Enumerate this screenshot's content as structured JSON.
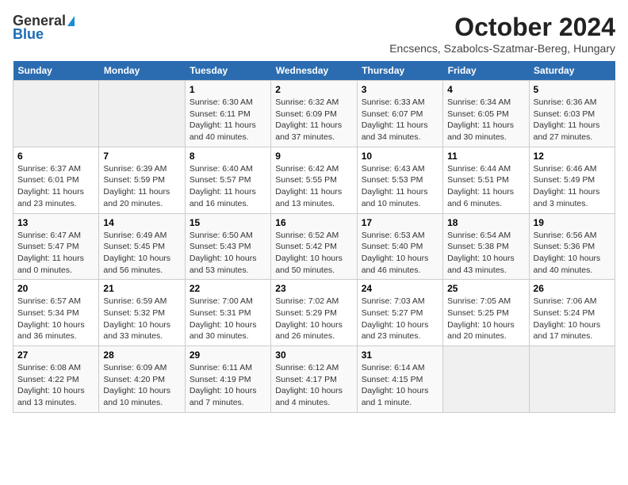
{
  "logo": {
    "line1": "General",
    "line2": "Blue"
  },
  "title": "October 2024",
  "subtitle": "Encsencs, Szabolcs-Szatmar-Bereg, Hungary",
  "weekdays": [
    "Sunday",
    "Monday",
    "Tuesday",
    "Wednesday",
    "Thursday",
    "Friday",
    "Saturday"
  ],
  "weeks": [
    [
      {
        "num": "",
        "sunrise": "",
        "sunset": "",
        "daylight": ""
      },
      {
        "num": "",
        "sunrise": "",
        "sunset": "",
        "daylight": ""
      },
      {
        "num": "1",
        "sunrise": "Sunrise: 6:30 AM",
        "sunset": "Sunset: 6:11 PM",
        "daylight": "Daylight: 11 hours and 40 minutes."
      },
      {
        "num": "2",
        "sunrise": "Sunrise: 6:32 AM",
        "sunset": "Sunset: 6:09 PM",
        "daylight": "Daylight: 11 hours and 37 minutes."
      },
      {
        "num": "3",
        "sunrise": "Sunrise: 6:33 AM",
        "sunset": "Sunset: 6:07 PM",
        "daylight": "Daylight: 11 hours and 34 minutes."
      },
      {
        "num": "4",
        "sunrise": "Sunrise: 6:34 AM",
        "sunset": "Sunset: 6:05 PM",
        "daylight": "Daylight: 11 hours and 30 minutes."
      },
      {
        "num": "5",
        "sunrise": "Sunrise: 6:36 AM",
        "sunset": "Sunset: 6:03 PM",
        "daylight": "Daylight: 11 hours and 27 minutes."
      }
    ],
    [
      {
        "num": "6",
        "sunrise": "Sunrise: 6:37 AM",
        "sunset": "Sunset: 6:01 PM",
        "daylight": "Daylight: 11 hours and 23 minutes."
      },
      {
        "num": "7",
        "sunrise": "Sunrise: 6:39 AM",
        "sunset": "Sunset: 5:59 PM",
        "daylight": "Daylight: 11 hours and 20 minutes."
      },
      {
        "num": "8",
        "sunrise": "Sunrise: 6:40 AM",
        "sunset": "Sunset: 5:57 PM",
        "daylight": "Daylight: 11 hours and 16 minutes."
      },
      {
        "num": "9",
        "sunrise": "Sunrise: 6:42 AM",
        "sunset": "Sunset: 5:55 PM",
        "daylight": "Daylight: 11 hours and 13 minutes."
      },
      {
        "num": "10",
        "sunrise": "Sunrise: 6:43 AM",
        "sunset": "Sunset: 5:53 PM",
        "daylight": "Daylight: 11 hours and 10 minutes."
      },
      {
        "num": "11",
        "sunrise": "Sunrise: 6:44 AM",
        "sunset": "Sunset: 5:51 PM",
        "daylight": "Daylight: 11 hours and 6 minutes."
      },
      {
        "num": "12",
        "sunrise": "Sunrise: 6:46 AM",
        "sunset": "Sunset: 5:49 PM",
        "daylight": "Daylight: 11 hours and 3 minutes."
      }
    ],
    [
      {
        "num": "13",
        "sunrise": "Sunrise: 6:47 AM",
        "sunset": "Sunset: 5:47 PM",
        "daylight": "Daylight: 11 hours and 0 minutes."
      },
      {
        "num": "14",
        "sunrise": "Sunrise: 6:49 AM",
        "sunset": "Sunset: 5:45 PM",
        "daylight": "Daylight: 10 hours and 56 minutes."
      },
      {
        "num": "15",
        "sunrise": "Sunrise: 6:50 AM",
        "sunset": "Sunset: 5:43 PM",
        "daylight": "Daylight: 10 hours and 53 minutes."
      },
      {
        "num": "16",
        "sunrise": "Sunrise: 6:52 AM",
        "sunset": "Sunset: 5:42 PM",
        "daylight": "Daylight: 10 hours and 50 minutes."
      },
      {
        "num": "17",
        "sunrise": "Sunrise: 6:53 AM",
        "sunset": "Sunset: 5:40 PM",
        "daylight": "Daylight: 10 hours and 46 minutes."
      },
      {
        "num": "18",
        "sunrise": "Sunrise: 6:54 AM",
        "sunset": "Sunset: 5:38 PM",
        "daylight": "Daylight: 10 hours and 43 minutes."
      },
      {
        "num": "19",
        "sunrise": "Sunrise: 6:56 AM",
        "sunset": "Sunset: 5:36 PM",
        "daylight": "Daylight: 10 hours and 40 minutes."
      }
    ],
    [
      {
        "num": "20",
        "sunrise": "Sunrise: 6:57 AM",
        "sunset": "Sunset: 5:34 PM",
        "daylight": "Daylight: 10 hours and 36 minutes."
      },
      {
        "num": "21",
        "sunrise": "Sunrise: 6:59 AM",
        "sunset": "Sunset: 5:32 PM",
        "daylight": "Daylight: 10 hours and 33 minutes."
      },
      {
        "num": "22",
        "sunrise": "Sunrise: 7:00 AM",
        "sunset": "Sunset: 5:31 PM",
        "daylight": "Daylight: 10 hours and 30 minutes."
      },
      {
        "num": "23",
        "sunrise": "Sunrise: 7:02 AM",
        "sunset": "Sunset: 5:29 PM",
        "daylight": "Daylight: 10 hours and 26 minutes."
      },
      {
        "num": "24",
        "sunrise": "Sunrise: 7:03 AM",
        "sunset": "Sunset: 5:27 PM",
        "daylight": "Daylight: 10 hours and 23 minutes."
      },
      {
        "num": "25",
        "sunrise": "Sunrise: 7:05 AM",
        "sunset": "Sunset: 5:25 PM",
        "daylight": "Daylight: 10 hours and 20 minutes."
      },
      {
        "num": "26",
        "sunrise": "Sunrise: 7:06 AM",
        "sunset": "Sunset: 5:24 PM",
        "daylight": "Daylight: 10 hours and 17 minutes."
      }
    ],
    [
      {
        "num": "27",
        "sunrise": "Sunrise: 6:08 AM",
        "sunset": "Sunset: 4:22 PM",
        "daylight": "Daylight: 10 hours and 13 minutes."
      },
      {
        "num": "28",
        "sunrise": "Sunrise: 6:09 AM",
        "sunset": "Sunset: 4:20 PM",
        "daylight": "Daylight: 10 hours and 10 minutes."
      },
      {
        "num": "29",
        "sunrise": "Sunrise: 6:11 AM",
        "sunset": "Sunset: 4:19 PM",
        "daylight": "Daylight: 10 hours and 7 minutes."
      },
      {
        "num": "30",
        "sunrise": "Sunrise: 6:12 AM",
        "sunset": "Sunset: 4:17 PM",
        "daylight": "Daylight: 10 hours and 4 minutes."
      },
      {
        "num": "31",
        "sunrise": "Sunrise: 6:14 AM",
        "sunset": "Sunset: 4:15 PM",
        "daylight": "Daylight: 10 hours and 1 minute."
      },
      {
        "num": "",
        "sunrise": "",
        "sunset": "",
        "daylight": ""
      },
      {
        "num": "",
        "sunrise": "",
        "sunset": "",
        "daylight": ""
      }
    ]
  ]
}
